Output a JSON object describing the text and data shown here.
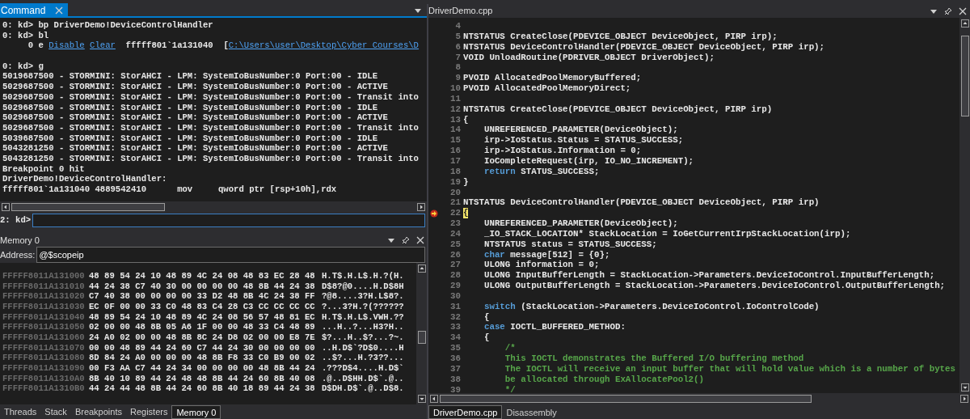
{
  "command_pane": {
    "tab": {
      "label": "Command",
      "selected": true
    },
    "output": [
      {
        "gap_after": false,
        "segments": [
          {
            "kind": "text",
            "text": "0: kd> bp DriverDemo!DeviceControlHandler"
          }
        ]
      },
      {
        "gap_after": false,
        "segments": [
          {
            "kind": "text",
            "text": "0: kd> bl"
          }
        ]
      },
      {
        "gap_after": true,
        "segments": [
          {
            "kind": "text",
            "text": "     0 e "
          },
          {
            "kind": "link",
            "text": "Disable"
          },
          {
            "kind": "link",
            "text": "Clear"
          },
          {
            "kind": "text",
            "text": "  fffff801`1a131040  ["
          },
          {
            "kind": "link",
            "text": "C:\\Users\\user\\Desktop\\Cyber Courses\\D"
          }
        ]
      },
      {
        "gap_after": false,
        "segments": [
          {
            "kind": "text",
            "text": "0: kd> g"
          }
        ]
      },
      {
        "gap_after": false,
        "segments": [
          {
            "kind": "text",
            "text": "5019687500 - STORMINI: StorAHCI - LPM: SystemIoBusNumber:0 Port:00 - IDLE"
          }
        ]
      },
      {
        "gap_after": false,
        "segments": [
          {
            "kind": "text",
            "text": "5029687500 - STORMINI: StorAHCI - LPM: SystemIoBusNumber:0 Port:00 - ACTIVE"
          }
        ]
      },
      {
        "gap_after": false,
        "segments": [
          {
            "kind": "text",
            "text": "5029687500 - STORMINI: StorAHCI - LPM: SystemIoBusNumber:0 Port:00 - Transit into"
          }
        ]
      },
      {
        "gap_after": false,
        "segments": [
          {
            "kind": "text",
            "text": "5029687500 - STORMINI: StorAHCI - LPM: SystemIoBusNumber:0 Port:00 - IDLE"
          }
        ]
      },
      {
        "gap_after": false,
        "segments": [
          {
            "kind": "text",
            "text": "5029687500 - STORMINI: StorAHCI - LPM: SystemIoBusNumber:0 Port:00 - ACTIVE"
          }
        ]
      },
      {
        "gap_after": false,
        "segments": [
          {
            "kind": "text",
            "text": "5029687500 - STORMINI: StorAHCI - LPM: SystemIoBusNumber:0 Port:00 - Transit into"
          }
        ]
      },
      {
        "gap_after": false,
        "segments": [
          {
            "kind": "text",
            "text": "5039687500 - STORMINI: StorAHCI - LPM: SystemIoBusNumber:0 Port:00 - IDLE"
          }
        ]
      },
      {
        "gap_after": false,
        "segments": [
          {
            "kind": "text",
            "text": "5043281250 - STORMINI: StorAHCI - LPM: SystemIoBusNumber:0 Port:00 - ACTIVE"
          }
        ]
      },
      {
        "gap_after": false,
        "segments": [
          {
            "kind": "text",
            "text": "5043281250 - STORMINI: StorAHCI - LPM: SystemIoBusNumber:0 Port:00 - Transit into"
          }
        ]
      },
      {
        "gap_after": false,
        "segments": [
          {
            "kind": "text",
            "text": "Breakpoint 0 hit"
          }
        ]
      },
      {
        "gap_after": false,
        "segments": [
          {
            "kind": "text",
            "text": "DriverDemo!DeviceControlHandler:"
          }
        ]
      },
      {
        "gap_after": false,
        "segments": [
          {
            "kind": "text",
            "text": "fffff801`1a131040 4889542410      mov     qword ptr [rsp+10h],rdx"
          }
        ]
      }
    ],
    "prompt": "2: kd>"
  },
  "memory_pane": {
    "title": "Memory 0",
    "address_label": "Address:",
    "address_value": "@$scopeip",
    "rows": [
      {
        "address": "FFFFF8011A131000",
        "bytes": "48 89 54 24 10 48 89 4C 24 08 48 83 EC 28 48",
        "ascii": "H.T$.H.L$.H.?(H."
      },
      {
        "address": "FFFFF8011A131010",
        "bytes": "44 24 38 C7 40 30 00 00 00 00 48 8B 44 24 38",
        "ascii": "D$8?@0....H.D$8H"
      },
      {
        "address": "FFFFF8011A131020",
        "bytes": "C7 40 38 00 00 00 00 33 D2 48 8B 4C 24 38 FF",
        "ascii": "?@8....3?H.L$8?."
      },
      {
        "address": "FFFFF8011A131030",
        "bytes": "EC 0F 00 00 33 C0 48 83 C4 28 C3 CC CC CC CC",
        "ascii": "?...3?H.?(??????"
      },
      {
        "address": "FFFFF8011A131040",
        "bytes": "48 89 54 24 10 48 89 4C 24 08 56 57 48 81 EC",
        "ascii": "H.T$.H.L$.VWH.??"
      },
      {
        "address": "FFFFF8011A131050",
        "bytes": "02 00 00 48 8B 05 A6 1F 00 00 48 33 C4 48 89",
        "ascii": "...H..?...H3?H.."
      },
      {
        "address": "FFFFF8011A131060",
        "bytes": "24 A0 02 00 00 48 8B 8C 24 D8 02 00 00 E8 7E",
        "ascii": "$?...H..$?...?~."
      },
      {
        "address": "FFFFF8011A131070",
        "bytes": "00 00 48 89 44 24 60 C7 44 24 30 00 00 00 00",
        "ascii": "..H.D$`?D$0....H"
      },
      {
        "address": "FFFFF8011A131080",
        "bytes": "8D 84 24 A0 00 00 00 48 8B F8 33 C0 B9 00 02",
        "ascii": "..$?...H.?3??..."
      },
      {
        "address": "FFFFF8011A131090",
        "bytes": "00 F3 AA C7 44 24 34 00 00 00 00 48 8B 44 24",
        "ascii": ".???D$4....H.D$`"
      },
      {
        "address": "FFFFF8011A1310A0",
        "bytes": "8B 40 10 89 44 24 48 48 8B 44 24 60 8B 40 08",
        "ascii": ".@..D$HH.D$`.@.."
      },
      {
        "address": "FFFFF8011A1310B0",
        "bytes": "44 24 44 48 8B 44 24 60 8B 40 18 89 44 24 38",
        "ascii": "D$DH.D$`.@..D$8."
      }
    ]
  },
  "left_tabs": [
    {
      "label": "Threads",
      "selected": false
    },
    {
      "label": "Stack",
      "selected": false
    },
    {
      "label": "Breakpoints",
      "selected": false
    },
    {
      "label": "Registers",
      "selected": false
    },
    {
      "label": "Memory 0",
      "selected": true
    }
  ],
  "editor": {
    "title": "DriverDemo.cpp",
    "lines": [
      {
        "number": "4",
        "current": false
      },
      {
        "number": "5",
        "current": false,
        "tokens": [
          {
            "kind": "plain",
            "text": "NTSTATUS CreateClose(PDEVICE_OBJECT DeviceObject, PIRP irp);"
          }
        ]
      },
      {
        "number": "6",
        "current": false,
        "tokens": [
          {
            "kind": "plain",
            "text": "NTSTATUS DeviceControlHandler(PDEVICE_OBJECT DeviceObject, PIRP irp);"
          }
        ]
      },
      {
        "number": "7",
        "current": false,
        "tokens": [
          {
            "kind": "plain",
            "text": "VOID UnloadRoutine(PDRIVER_OBJECT DriverObject);"
          }
        ]
      },
      {
        "number": "8",
        "current": false
      },
      {
        "number": "9",
        "current": false,
        "tokens": [
          {
            "kind": "plain",
            "text": "PVOID AllocatedPoolMemoryBuffered;"
          }
        ]
      },
      {
        "number": "10",
        "current": false,
        "tokens": [
          {
            "kind": "plain",
            "text": "PVOID AllocatedPoolMemoryDirect;"
          }
        ]
      },
      {
        "number": "11",
        "current": false
      },
      {
        "number": "12",
        "current": false,
        "tokens": [
          {
            "kind": "plain",
            "text": "NTSTATUS CreateClose(PDEVICE_OBJECT DeviceObject, PIRP irp)"
          }
        ]
      },
      {
        "number": "13",
        "current": false,
        "tokens": [
          {
            "kind": "plain",
            "text": "{"
          }
        ]
      },
      {
        "number": "14",
        "current": false,
        "tokens": [
          {
            "kind": "plain",
            "text": "    UNREFERENCED_PARAMETER(DeviceObject);"
          }
        ]
      },
      {
        "number": "15",
        "current": false,
        "tokens": [
          {
            "kind": "plain",
            "text": "    irp->IoStatus.Status = STATUS_SUCCESS;"
          }
        ]
      },
      {
        "number": "16",
        "current": false,
        "tokens": [
          {
            "kind": "plain",
            "text": "    irp->IoStatus.Information = 0;"
          }
        ]
      },
      {
        "number": "17",
        "current": false,
        "tokens": [
          {
            "kind": "plain",
            "text": "    IoCompleteRequest(irp, IO_NO_INCREMENT);"
          }
        ]
      },
      {
        "number": "18",
        "current": false,
        "tokens": [
          {
            "kind": "keyword",
            "text": "    return"
          },
          {
            "kind": "plain",
            "text": " STATUS_SUCCESS;"
          }
        ]
      },
      {
        "number": "19",
        "current": false,
        "tokens": [
          {
            "kind": "plain",
            "text": "}"
          }
        ]
      },
      {
        "number": "20",
        "current": false
      },
      {
        "number": "21",
        "current": false,
        "tokens": [
          {
            "kind": "plain",
            "text": "NTSTATUS DeviceControlHandler(PDEVICE_OBJECT DeviceObject, PIRP irp)"
          }
        ]
      },
      {
        "number": "22",
        "current": true,
        "tokens": [
          {
            "kind": "plain",
            "text": "{"
          }
        ]
      },
      {
        "number": "23",
        "current": false,
        "tokens": [
          {
            "kind": "plain",
            "text": "    UNREFERENCED_PARAMETER(DeviceObject);"
          }
        ]
      },
      {
        "number": "24",
        "current": false,
        "tokens": [
          {
            "kind": "plain",
            "text": "    _IO_STACK_LOCATION* StackLocation = IoGetCurrentIrpStackLocation(irp);"
          }
        ]
      },
      {
        "number": "25",
        "current": false,
        "tokens": [
          {
            "kind": "plain",
            "text": "    NTSTATUS status = STATUS_SUCCESS;"
          }
        ]
      },
      {
        "number": "26",
        "current": false,
        "tokens": [
          {
            "kind": "keyword",
            "text": "    char"
          },
          {
            "kind": "plain",
            "text": " message[512] = {0};"
          }
        ]
      },
      {
        "number": "27",
        "current": false,
        "tokens": [
          {
            "kind": "plain",
            "text": "    ULONG information = 0;"
          }
        ]
      },
      {
        "number": "28",
        "current": false,
        "tokens": [
          {
            "kind": "plain",
            "text": "    ULONG InputBufferLength = StackLocation->Parameters.DeviceIoControl.InputBufferLength;"
          }
        ]
      },
      {
        "number": "29",
        "current": false,
        "tokens": [
          {
            "kind": "plain",
            "text": "    ULONG OutputBufferLength = StackLocation->Parameters.DeviceIoControl.OutputBufferLength;"
          }
        ]
      },
      {
        "number": "30",
        "current": false
      },
      {
        "number": "31",
        "current": false,
        "tokens": [
          {
            "kind": "keyword",
            "text": "    switch"
          },
          {
            "kind": "plain",
            "text": " (StackLocation->Parameters.DeviceIoControl.IoControlCode)"
          }
        ]
      },
      {
        "number": "32",
        "current": false,
        "tokens": [
          {
            "kind": "plain",
            "text": "    {"
          }
        ]
      },
      {
        "number": "33",
        "current": false,
        "tokens": [
          {
            "kind": "keyword",
            "text": "    case"
          },
          {
            "kind": "plain",
            "text": " IOCTL_BUFFERED_METHOD:"
          }
        ]
      },
      {
        "number": "34",
        "current": false,
        "tokens": [
          {
            "kind": "plain",
            "text": "    {"
          }
        ]
      },
      {
        "number": "35",
        "current": false,
        "tokens": [
          {
            "kind": "comment",
            "text": "        /*"
          }
        ]
      },
      {
        "number": "36",
        "current": false,
        "tokens": [
          {
            "kind": "comment",
            "text": "        This IOCTL demonstrates the Buffered I/O buffering method"
          }
        ]
      },
      {
        "number": "37",
        "current": false,
        "tokens": [
          {
            "kind": "comment",
            "text": "        The IOCTL will receive an input buffer that will hold value which is a number of bytes"
          }
        ]
      },
      {
        "number": "38",
        "current": false,
        "tokens": [
          {
            "kind": "comment",
            "text": "        be allocated through ExAllocatePool2()"
          }
        ]
      },
      {
        "number": "39",
        "current": false,
        "tokens": [
          {
            "kind": "comment",
            "text": "        */"
          }
        ]
      }
    ]
  },
  "right_tabs": [
    {
      "label": "DriverDemo.cpp",
      "selected": true
    },
    {
      "label": "Disassembly",
      "selected": false
    }
  ]
}
